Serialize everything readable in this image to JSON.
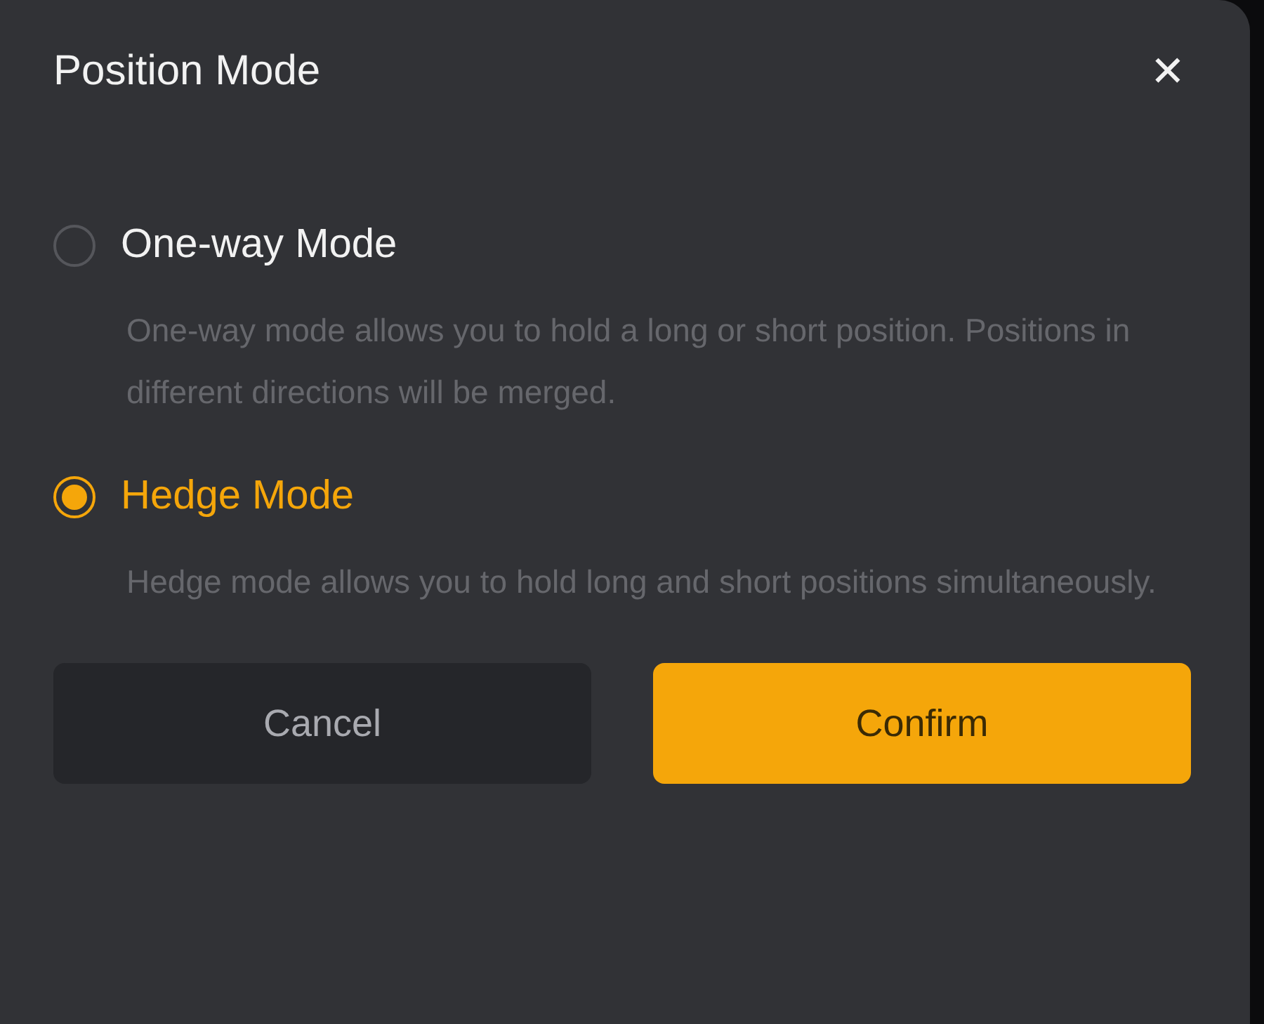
{
  "dialog": {
    "title": "Position Mode",
    "close": "✕"
  },
  "options": [
    {
      "label": "One-way Mode",
      "description": "One-way mode allows you to hold a long or short position. Positions in different directions will be merged.",
      "selected": false
    },
    {
      "label": "Hedge Mode",
      "description": "Hedge mode allows you to hold long and short positions simultaneously.",
      "selected": true
    }
  ],
  "buttons": [
    {
      "label": "Cancel",
      "kind": "secondary"
    },
    {
      "label": "Confirm",
      "kind": "primary"
    }
  ]
}
